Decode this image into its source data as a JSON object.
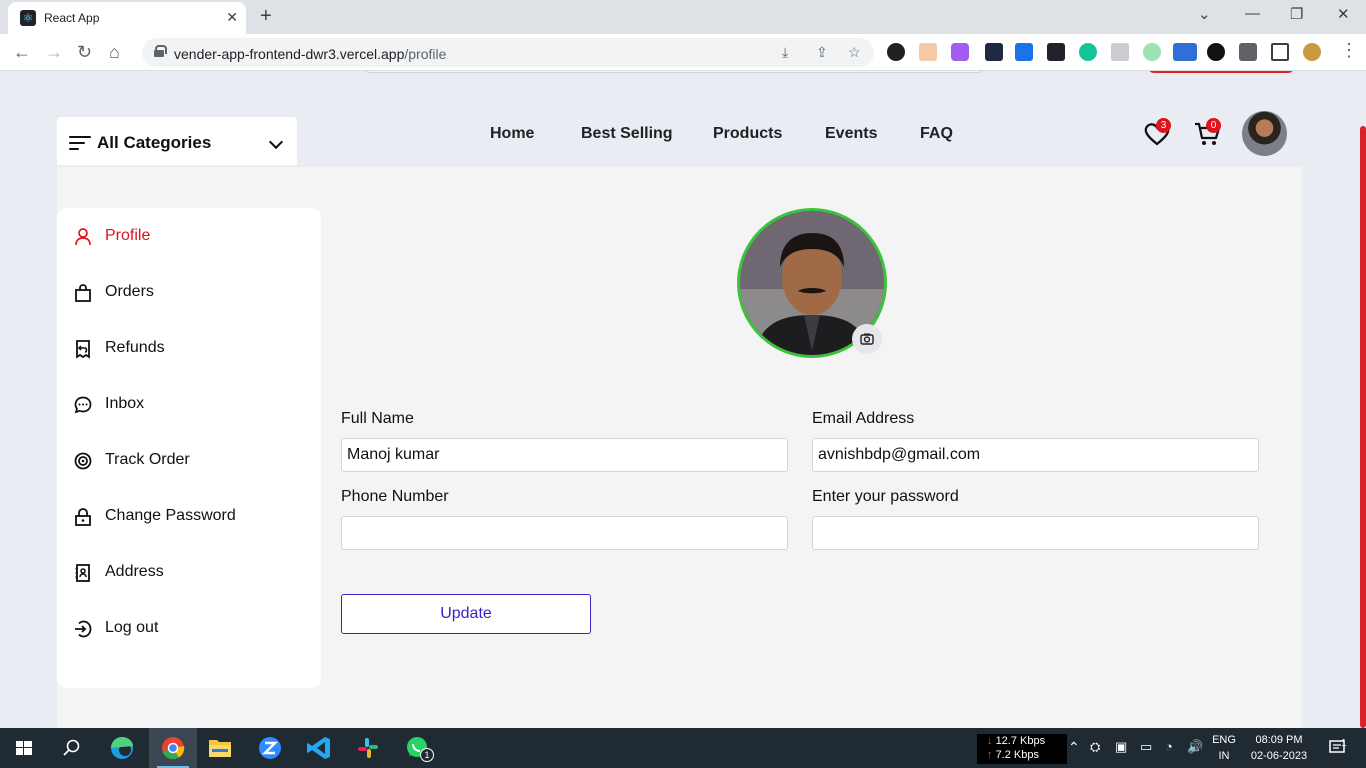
{
  "browser": {
    "tab_title": "React App",
    "url_domain": "vender-app-frontend-dwr3.vercel.app",
    "url_path": "/profile"
  },
  "header": {
    "categories_label": "All Categories",
    "nav": [
      "Home",
      "Best Selling",
      "Products",
      "Events",
      "FAQ"
    ],
    "wishlist_count": "3",
    "cart_count": "0"
  },
  "sidebar": {
    "items": [
      {
        "label": "Profile",
        "icon": "person-icon",
        "active": true
      },
      {
        "label": "Orders",
        "icon": "shopping-bag-icon"
      },
      {
        "label": "Refunds",
        "icon": "receipt-refund-icon"
      },
      {
        "label": "Inbox",
        "icon": "chat-bubble-icon"
      },
      {
        "label": "Track Order",
        "icon": "track-order-icon"
      },
      {
        "label": "Change Password",
        "icon": "lock-icon"
      },
      {
        "label": "Address",
        "icon": "address-book-icon"
      },
      {
        "label": "Log out",
        "icon": "logout-icon"
      }
    ]
  },
  "form": {
    "full_name_label": "Full Name",
    "full_name_value": "Manoj kumar",
    "email_label": "Email Address",
    "email_value": "avnishbdp@gmail.com",
    "phone_label": "Phone Number",
    "phone_value": "",
    "password_label": "Enter your password",
    "password_value": "",
    "update_label": "Update"
  },
  "taskbar": {
    "download_speed": "12.7 Kbps",
    "upload_speed": "7.2 Kbps",
    "lang_1": "ENG",
    "lang_2": "IN",
    "time": "08:09 PM",
    "date": "02-06-2023",
    "notification_count": "1",
    "whatsapp_badge": "1"
  },
  "colors": {
    "accent_red": "#e0121e",
    "update_blue": "#3a24c4",
    "avatar_ring_green": "#3bc43b"
  }
}
